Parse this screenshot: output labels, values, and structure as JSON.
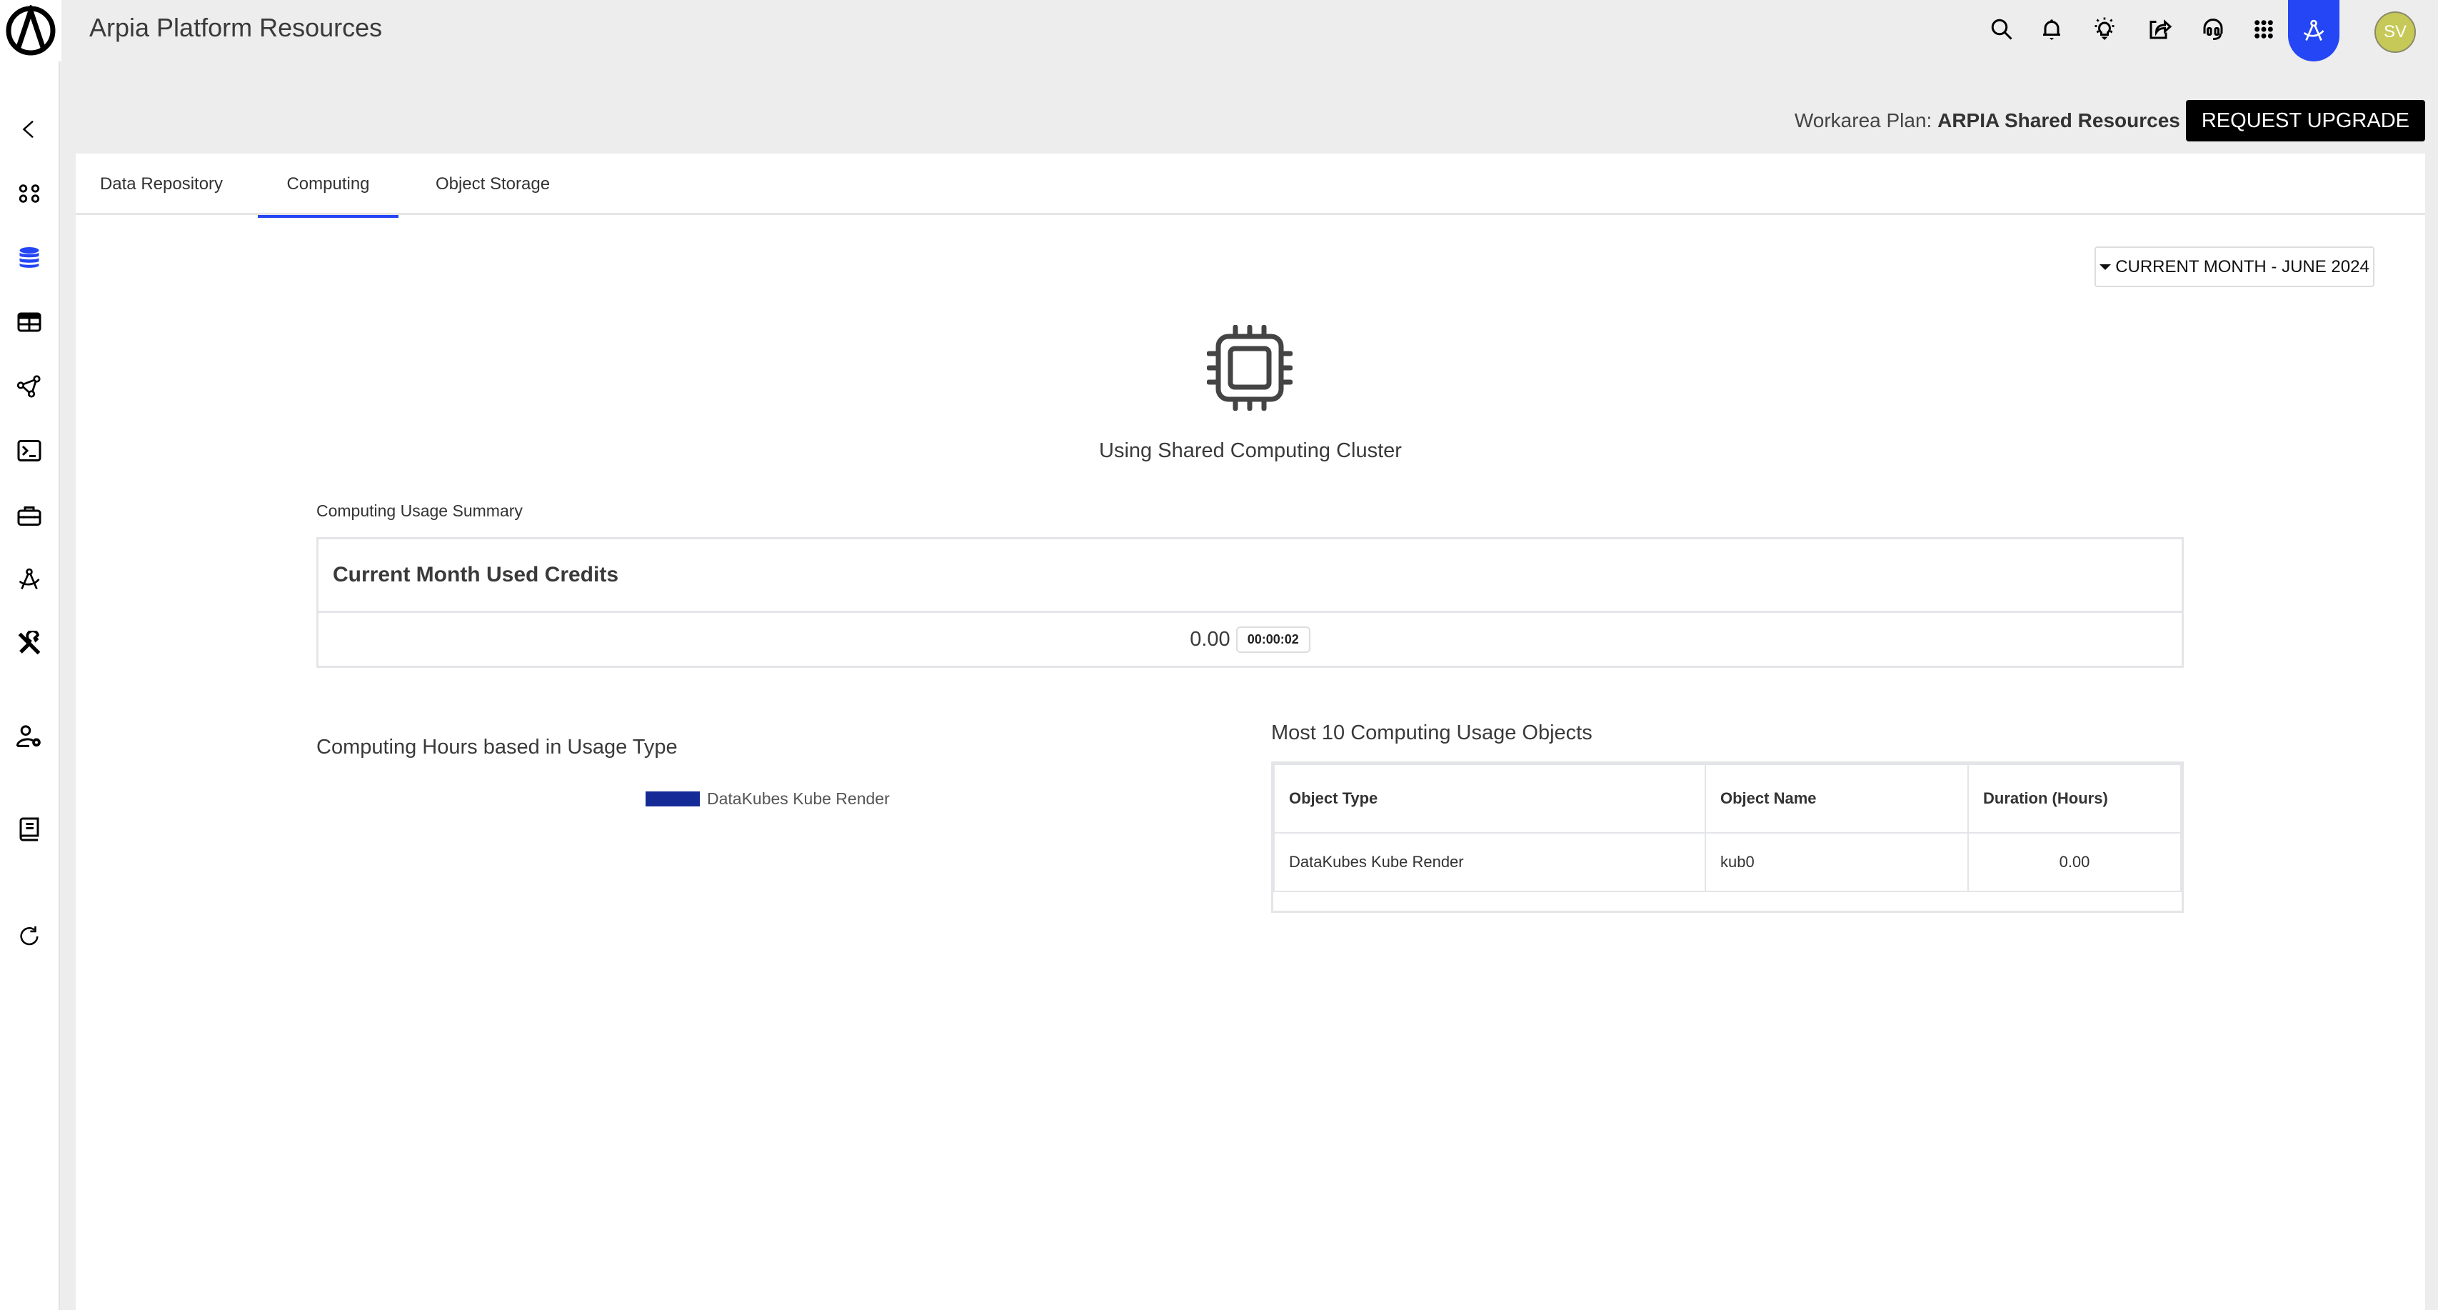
{
  "app": {
    "title": "Arpia Platform Resources",
    "avatar_initials": "SV"
  },
  "topbar_icons": [
    "search-icon",
    "bell-icon",
    "lightbulb-icon",
    "share-icon",
    "headset-icon",
    "apps-grid-icon",
    "compass-tool-icon"
  ],
  "sidebar": {
    "items": [
      {
        "icon": "chevron-left-icon",
        "active": false
      },
      {
        "icon": "dashboard-icon",
        "active": false
      },
      {
        "icon": "database-icon",
        "active": true
      },
      {
        "icon": "table-icon",
        "active": false
      },
      {
        "icon": "network-icon",
        "active": false
      },
      {
        "icon": "terminal-icon",
        "active": false
      },
      {
        "icon": "toolbox-icon",
        "active": false
      },
      {
        "icon": "compass-tool-icon",
        "active": false
      },
      {
        "icon": "tools-icon",
        "active": false
      },
      {
        "icon": "user-settings-icon",
        "active": false
      },
      {
        "icon": "book-icon",
        "active": false
      },
      {
        "icon": "refresh-icon",
        "active": false
      }
    ]
  },
  "plan": {
    "label": "Workarea Plan:",
    "name": "ARPIA Shared Resources",
    "upgrade_button": "REQUEST UPGRADE"
  },
  "tabs": [
    {
      "label": "Data Repository",
      "active": false
    },
    {
      "label": "Computing",
      "active": true
    },
    {
      "label": "Object Storage",
      "active": false
    }
  ],
  "period_dropdown": {
    "selected": "CURRENT MONTH - JUNE 2024"
  },
  "cluster": {
    "caption": "Using Shared Computing Cluster"
  },
  "summary": {
    "label": "Computing Usage Summary",
    "header": "Current Month Used Credits",
    "credits": "0.00",
    "elapsed": "00:00:02"
  },
  "chart_section": {
    "title": "Computing Hours based in Usage Type"
  },
  "chart_data": {
    "type": "pie",
    "title": "Computing Hours based in Usage Type",
    "legend": [
      {
        "label": "DataKubes Kube Render",
        "color": "#142a97"
      }
    ],
    "categories": [
      "DataKubes Kube Render"
    ],
    "values": [
      0.0
    ],
    "legend_position": "top"
  },
  "usage_table": {
    "title": "Most 10 Computing Usage Objects",
    "columns": [
      "Object Type",
      "Object Name",
      "Duration (Hours)"
    ],
    "rows": [
      [
        "DataKubes Kube Render",
        "kub0",
        "0.00"
      ]
    ]
  },
  "colors": {
    "accent": "#2446f5",
    "legend_series": "#142a97",
    "avatar": "#c6c957"
  }
}
